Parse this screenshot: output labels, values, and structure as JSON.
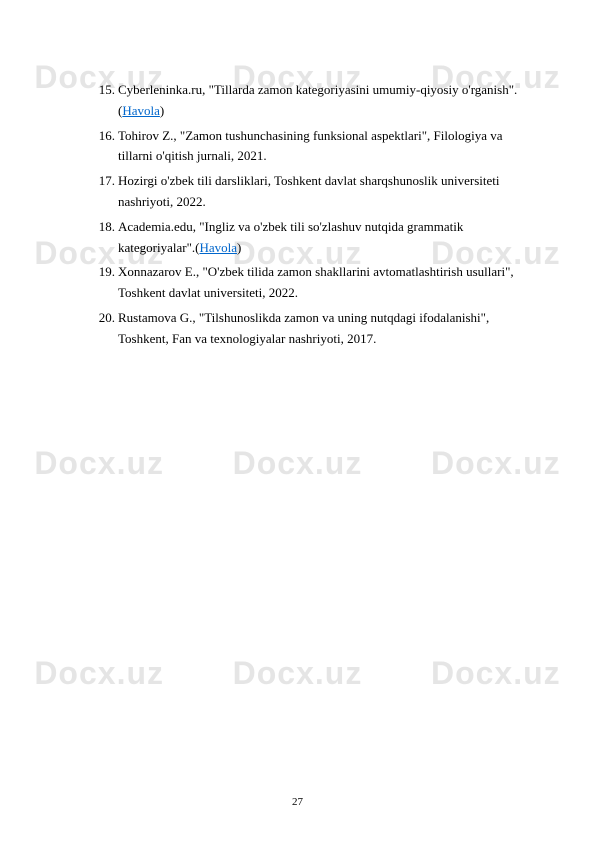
{
  "watermark": "Docx.uz",
  "page_number": "27",
  "references": [
    {
      "num": "15.",
      "text_before": "Cyberleninka.ru, \"Tillarda zamon kategoriyasini umumiy-qiyosiy o'rganish\".(",
      "link": "Havola",
      "text_after": ")"
    },
    {
      "num": "16.",
      "text_before": " Tohirov Z., \"Zamon tushunchasining funksional aspektlari\", Filologiya va tillarni o'qitish jurnali, 2021.",
      "link": "",
      "text_after": ""
    },
    {
      "num": "17.",
      "text_before": "Hozirgi o'zbek tili darsliklari, Toshkent davlat sharqshunoslik universiteti nashriyoti, 2022.",
      "link": "",
      "text_after": ""
    },
    {
      "num": "18.",
      "text_before": "Academia.edu, \"Ingliz va o'zbek tili so'zlashuv nutqida grammatik kategoriyalar\".(",
      "link": "Havola",
      "text_after": ")"
    },
    {
      "num": "19.",
      "text_before": "Xonnazarov E., \"O'zbek tilida zamon shakllarini avtomatlashtirish usullari\", Toshkent davlat universiteti, 2022.",
      "link": "",
      "text_after": ""
    },
    {
      "num": "20.",
      "text_before": "Rustamova G., \"Tilshunoslikda zamon va uning nutqdagi ifodalanishi\", Toshkent, Fan va texnologiyalar nashriyoti, 2017.",
      "link": "",
      "text_after": ""
    }
  ]
}
